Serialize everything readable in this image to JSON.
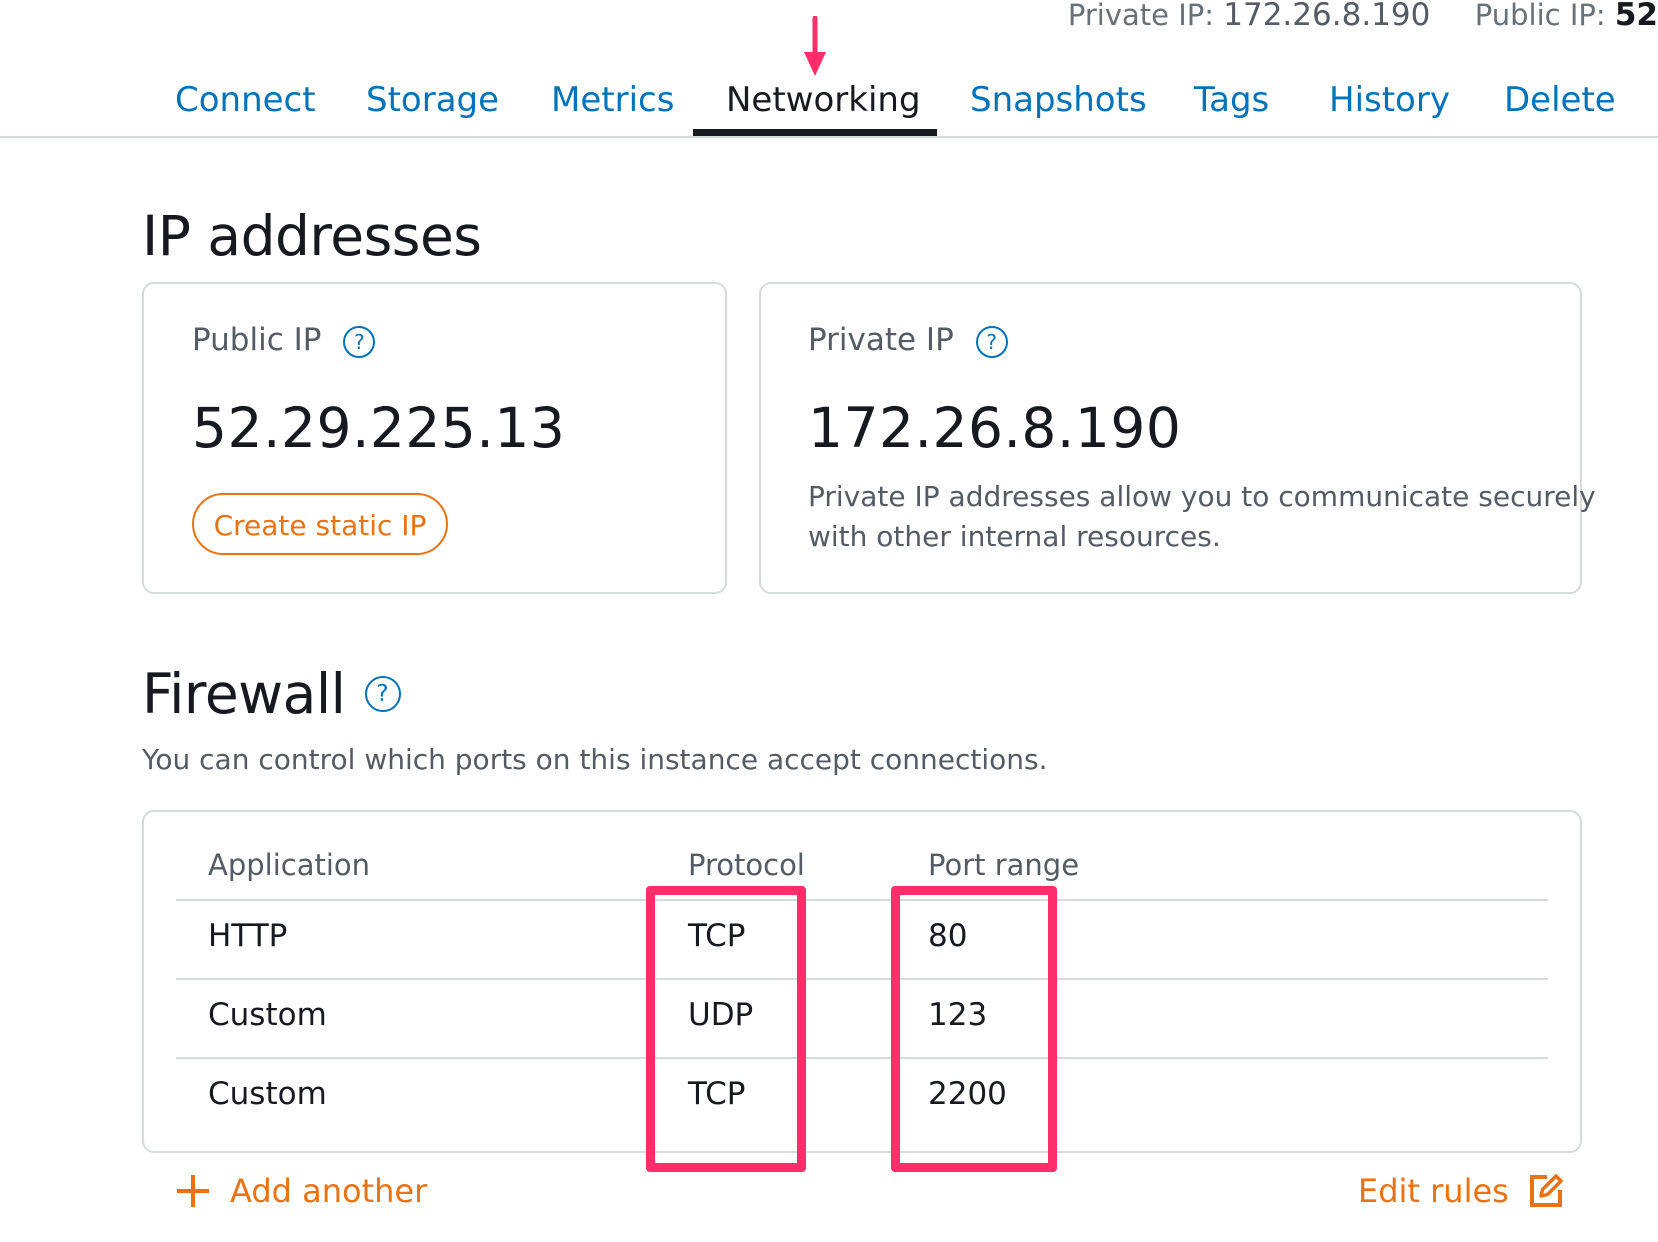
{
  "header": {
    "private_ip_label": "Private IP:",
    "private_ip_value": "172.26.8.190",
    "public_ip_label": "Public IP:",
    "public_ip_value": "52"
  },
  "tabs": [
    {
      "label": "Connect"
    },
    {
      "label": "Storage"
    },
    {
      "label": "Metrics"
    },
    {
      "label": "Networking"
    },
    {
      "label": "Snapshots"
    },
    {
      "label": "Tags"
    },
    {
      "label": "History"
    },
    {
      "label": "Delete"
    }
  ],
  "active_tab": "Networking",
  "ip_section": {
    "title": "IP addresses",
    "public": {
      "label": "Public IP",
      "value": "52.29.225.13",
      "button": "Create static IP"
    },
    "private": {
      "label": "Private IP",
      "value": "172.26.8.190",
      "description_line1": "Private IP addresses allow you to communicate securely",
      "description_line2": "with other internal resources."
    }
  },
  "firewall": {
    "title": "Firewall",
    "description": "You can control which ports on this instance accept connections.",
    "columns": [
      "Application",
      "Protocol",
      "Port range"
    ],
    "rows": [
      {
        "application": "HTTP",
        "protocol": "TCP",
        "port": "80"
      },
      {
        "application": "Custom",
        "protocol": "UDP",
        "port": "123"
      },
      {
        "application": "Custom",
        "protocol": "TCP",
        "port": "2200"
      }
    ],
    "add_label": "Add another",
    "edit_label": "Edit rules"
  },
  "icons": {
    "help": "question-circle-icon",
    "add": "plus-icon",
    "edit": "edit-icon",
    "annotation": "arrow-down-icon"
  },
  "colors": {
    "link": "#0073bb",
    "accent": "#ec7211",
    "highlight": "#ff2d6a",
    "text": "#16191f"
  }
}
